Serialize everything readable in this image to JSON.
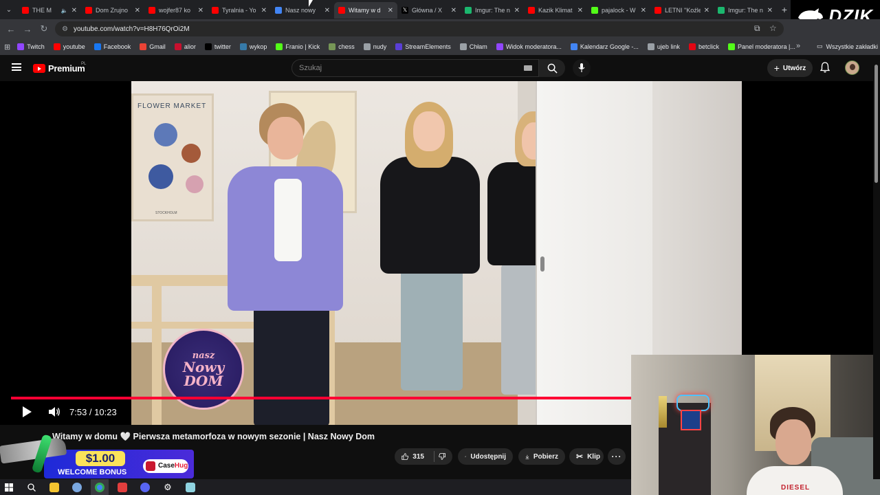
{
  "browser": {
    "tabs": [
      {
        "title": "THE M",
        "favicon": "yt",
        "audio": true
      },
      {
        "title": "Dom Zrujno",
        "favicon": "yt"
      },
      {
        "title": "wojfer87 ko",
        "favicon": "yt"
      },
      {
        "title": "Tyralnia - Yo",
        "favicon": "yt"
      },
      {
        "title": "Nasz nowy",
        "favicon": "chrome"
      },
      {
        "title": "Witamy w d",
        "favicon": "yt",
        "active": true
      },
      {
        "title": "Główna / X",
        "favicon": "x"
      },
      {
        "title": "Imgur: The n",
        "favicon": "imgur"
      },
      {
        "title": "Kazik Klimat",
        "favicon": "yt"
      },
      {
        "title": "pajalock - W",
        "favicon": "kick"
      },
      {
        "title": "LETNI \"Koźle",
        "favicon": "yt"
      },
      {
        "title": "Imgur: The n",
        "favicon": "imgur"
      }
    ],
    "new_tab": "+",
    "url": "youtube.com/watch?v=H8H76QrOi2M",
    "bookmarks": [
      {
        "label": "Twitch",
        "color": "#9146ff"
      },
      {
        "label": "youtube",
        "color": "#ff0000"
      },
      {
        "label": "Facebook",
        "color": "#1877f2"
      },
      {
        "label": "Gmail",
        "color": "#ea4335"
      },
      {
        "label": "alior",
        "color": "#c8102e"
      },
      {
        "label": "twitter",
        "color": "#000000"
      },
      {
        "label": "wykop",
        "color": "#367aa9"
      },
      {
        "label": "Franio | Kick",
        "color": "#53fc18"
      },
      {
        "label": "chess",
        "color": "#769656"
      },
      {
        "label": "nudy",
        "color": "#9aa0a6"
      },
      {
        "label": "StreamElements",
        "color": "#5a3fd6"
      },
      {
        "label": "Chłam",
        "color": "#9aa0a6"
      },
      {
        "label": "Widok moderatora...",
        "color": "#9146ff"
      },
      {
        "label": "Kalendarz Google -...",
        "color": "#4285f4"
      },
      {
        "label": "ujeb link",
        "color": "#9aa0a6"
      },
      {
        "label": "betclick",
        "color": "#e30613"
      },
      {
        "label": "Panel moderatora |...",
        "color": "#53fc18"
      }
    ],
    "all_bookmarks": "Wszystkie zakładki"
  },
  "overlay_brand": "DZIK",
  "youtube": {
    "logo_text": "Premium",
    "region": "PL",
    "search_placeholder": "Szukaj",
    "create_label": "Utwórz"
  },
  "video": {
    "poster_text": "FLOWER MARKET",
    "poster_small": "STOCKHOLM",
    "show_logo": [
      "nasz",
      "Nowy",
      "DOM"
    ],
    "current_time": "7:53",
    "duration": "10:23",
    "time_display": "7:53 / 10:23",
    "progress": 0.7544,
    "title": "Witamy w domu 🤍 Pierwsza metamorfoza w nowym sezonie | Nasz Nowy Dom",
    "likes": "315",
    "share_label": "Udostępnij",
    "download_label": "Pobierz",
    "clip_label": "Klip"
  },
  "promo": {
    "amount": "$1.00",
    "subtitle": "WELCOME BONUS",
    "brand_a": "Case",
    "brand_b": "Hug"
  },
  "webcam": {
    "shirt_text": "DIESEL"
  },
  "colors": {
    "accent_red": "#ff0033",
    "yt_bg": "#0f0f0f"
  }
}
